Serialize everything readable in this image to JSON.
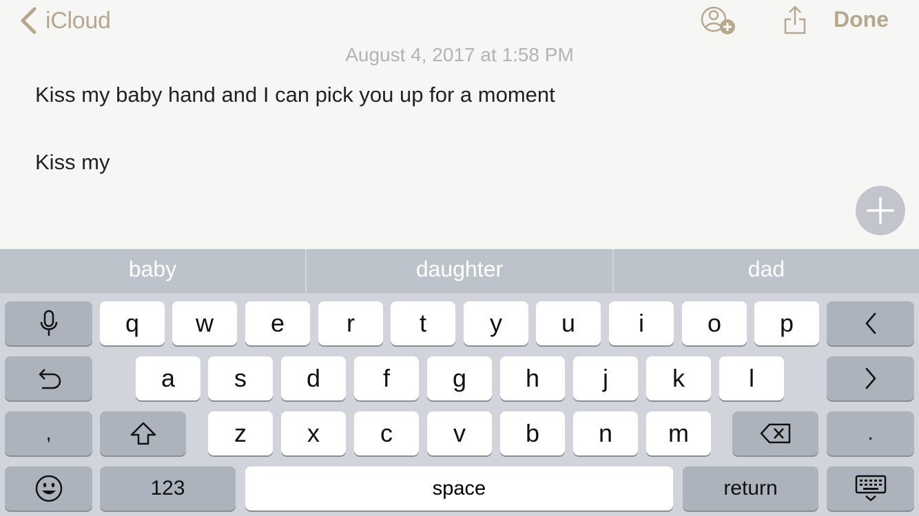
{
  "nav": {
    "back_label": "iCloud",
    "done_label": "Done"
  },
  "note": {
    "timestamp": "August 4, 2017 at 1:58 PM",
    "lines": [
      "Kiss my baby hand and I can pick you up for a moment",
      "Kiss my"
    ]
  },
  "keyboard": {
    "suggestions": [
      "baby",
      "daughter",
      "dad"
    ],
    "row1": [
      "q",
      "w",
      "e",
      "r",
      "t",
      "y",
      "u",
      "i",
      "o",
      "p"
    ],
    "row2": [
      "a",
      "s",
      "d",
      "f",
      "g",
      "h",
      "j",
      "k",
      "l"
    ],
    "row3": [
      "z",
      "x",
      "c",
      "v",
      "b",
      "n",
      "m"
    ],
    "comma_label": ",",
    "period_label": ".",
    "numbers_label": "123",
    "space_label": "space",
    "return_label": "return"
  },
  "colors": {
    "accent": "#b5a88d",
    "note_background": "#f6f6f5",
    "keyboard_background": "#d1d5db",
    "suggestion_bar": "#bcc3ca",
    "function_key": "#acb3bc"
  },
  "icons": {
    "back": "chevron-left-icon",
    "share_person": "person-add-icon",
    "share": "share-icon",
    "add": "plus-icon",
    "mic": "microphone-icon",
    "undo": "undo-icon",
    "shift": "shift-icon",
    "delete": "delete-icon",
    "emoji": "emoji-icon",
    "left": "chevron-left-icon",
    "right": "chevron-right-icon",
    "dismiss": "keyboard-dismiss-icon"
  }
}
